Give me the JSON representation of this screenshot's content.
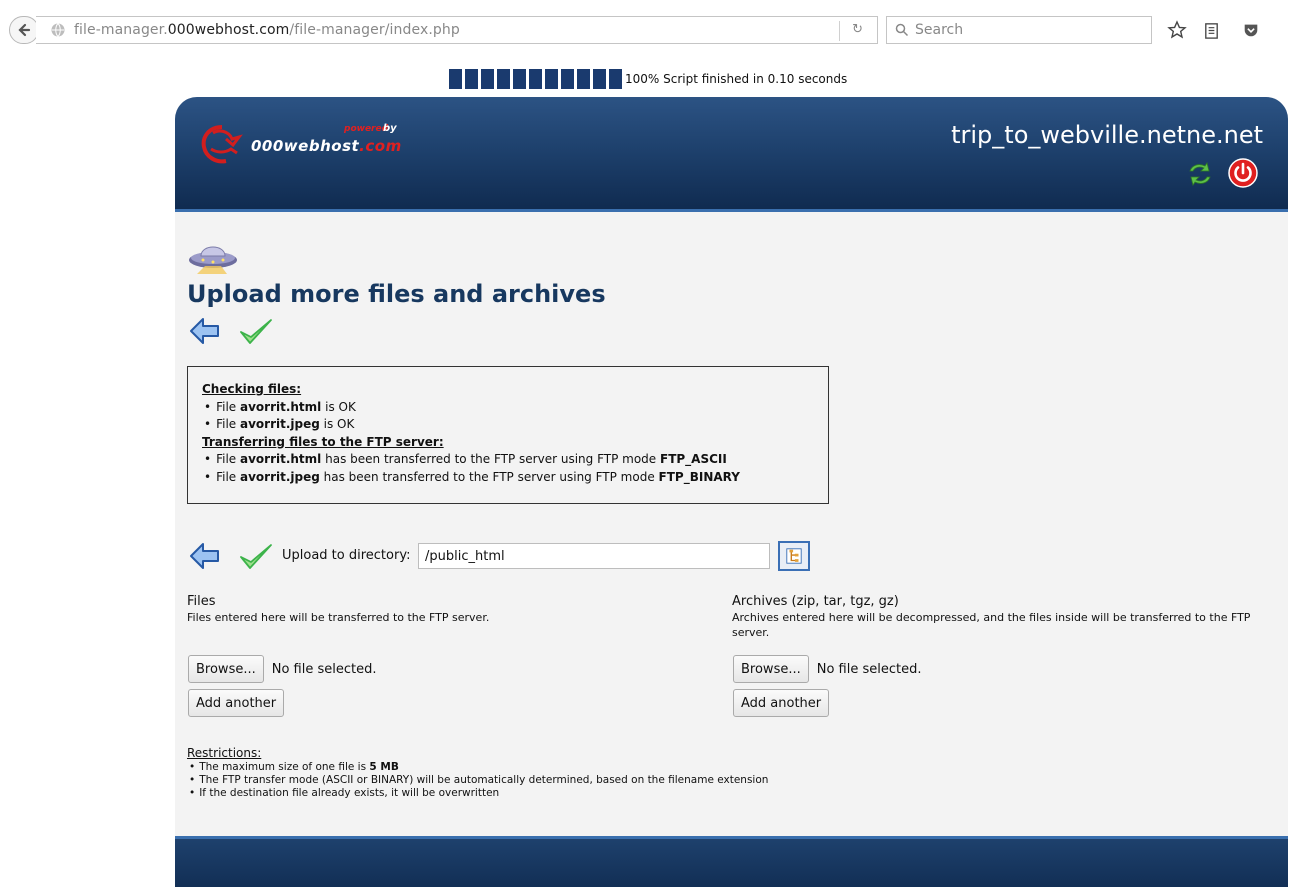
{
  "browser": {
    "url_prefix": "file-manager.",
    "url_host": "000webhost.com",
    "url_path": "/file-manager/index.php",
    "search_placeholder": "Search"
  },
  "progress": {
    "percent": 100,
    "block_count": 11,
    "text": "100% Script finished in 0.10 seconds"
  },
  "header": {
    "logo_powered": "powered",
    "logo_by": "by",
    "logo_name": "000webhost",
    "logo_dotcom": ".com",
    "site_name": "trip_to_webville.netne.net"
  },
  "page": {
    "title": "Upload more files and archives"
  },
  "status": {
    "checking_header": "Checking files:",
    "checking_items": [
      {
        "prefix": "File ",
        "file": "avorrit.html",
        "suffix": " is OK"
      },
      {
        "prefix": "File ",
        "file": "avorrit.jpeg",
        "suffix": " is OK"
      }
    ],
    "transfer_header": "Transferring files to the FTP server:",
    "transfer_items": [
      {
        "prefix": "File ",
        "file": "avorrit.html",
        "middle": " has been transferred to the FTP server using FTP mode ",
        "mode": "FTP_ASCII"
      },
      {
        "prefix": "File ",
        "file": "avorrit.jpeg",
        "middle": " has been transferred to the FTP server using FTP mode ",
        "mode": "FTP_BINARY"
      }
    ]
  },
  "upload": {
    "label": "Upload to directory:",
    "directory": "/public_html"
  },
  "files": {
    "title": "Files",
    "desc": "Files entered here will be transferred to the FTP server.",
    "browse_label": "Browse...",
    "no_file": "No file selected.",
    "add_another": "Add another"
  },
  "archives": {
    "title": "Archives (zip, tar, tgz, gz)",
    "desc": "Archives entered here will be decompressed, and the files inside will be transferred to the FTP server.",
    "browse_label": "Browse...",
    "no_file": "No file selected.",
    "add_another": "Add another"
  },
  "restrictions": {
    "header": "Restrictions:",
    "item1_prefix": "The maximum size of one file is ",
    "item1_value": "5 MB",
    "item2": "The FTP transfer mode (ASCII or BINARY) will be automatically determined, based on the filename extension",
    "item3": "If the destination file already exists, it will be overwritten"
  },
  "colors": {
    "header_dark": "#0f2a4f",
    "title_blue": "#17385f",
    "accent_red": "#e02020",
    "check_green": "#3cb34a"
  },
  "icons": [
    "back-arrow-icon",
    "globe-icon",
    "reload-icon",
    "search-icon",
    "bookmark-star-icon",
    "reading-list-icon",
    "pocket-icon",
    "logo-icon",
    "refresh-icon",
    "power-icon",
    "ufo-icon",
    "blue-back-arrow-icon",
    "green-check-icon",
    "directory-tree-icon"
  ]
}
